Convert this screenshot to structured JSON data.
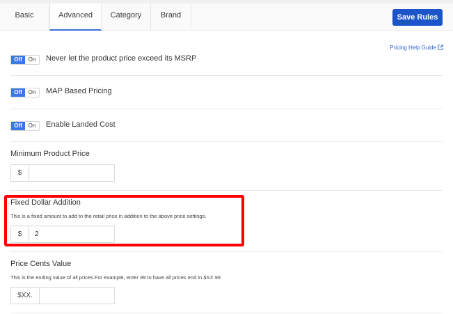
{
  "tabs": [
    {
      "label": "Basic",
      "active": false
    },
    {
      "label": "Advanced",
      "active": true
    },
    {
      "label": "Category",
      "active": false
    },
    {
      "label": "Brand",
      "active": false
    }
  ],
  "toolbar": {
    "save_label": "Save Rules"
  },
  "help_link": {
    "label": "Pricing Help Guide",
    "icon": "external-link-icon"
  },
  "toggles": [
    {
      "off_label": "Off",
      "on_label": "On",
      "state": "Off",
      "label": "Never let the product price exceed its MSRP"
    },
    {
      "off_label": "Off",
      "on_label": "On",
      "state": "Off",
      "label": "MAP Based Pricing"
    },
    {
      "off_label": "Off",
      "on_label": "On",
      "state": "Off",
      "label": "Enable Landed Cost"
    }
  ],
  "min_price": {
    "label": "Minimum Product Price",
    "prefix": "$",
    "value": ""
  },
  "fixed_dollar": {
    "label": "Fixed Dollar Addition",
    "help": "This is a fixed amount to add to the retail price in addition to the above price settings.",
    "prefix": "$",
    "value": "2"
  },
  "cents": {
    "label": "Price Cents Value",
    "help_prefix": "This is the ending value of all prices.For example, enter ",
    "help_example_value": "99",
    "help_middle": " to have all prices end in ",
    "help_example_result": "$XX.99",
    "help_suffix": ".",
    "prefix": "$XX.",
    "value": ""
  },
  "colors": {
    "accent": "#1b55c9",
    "toggle_off": "#3b78e7",
    "highlight": "#ff0000",
    "link": "#2a62c9"
  }
}
